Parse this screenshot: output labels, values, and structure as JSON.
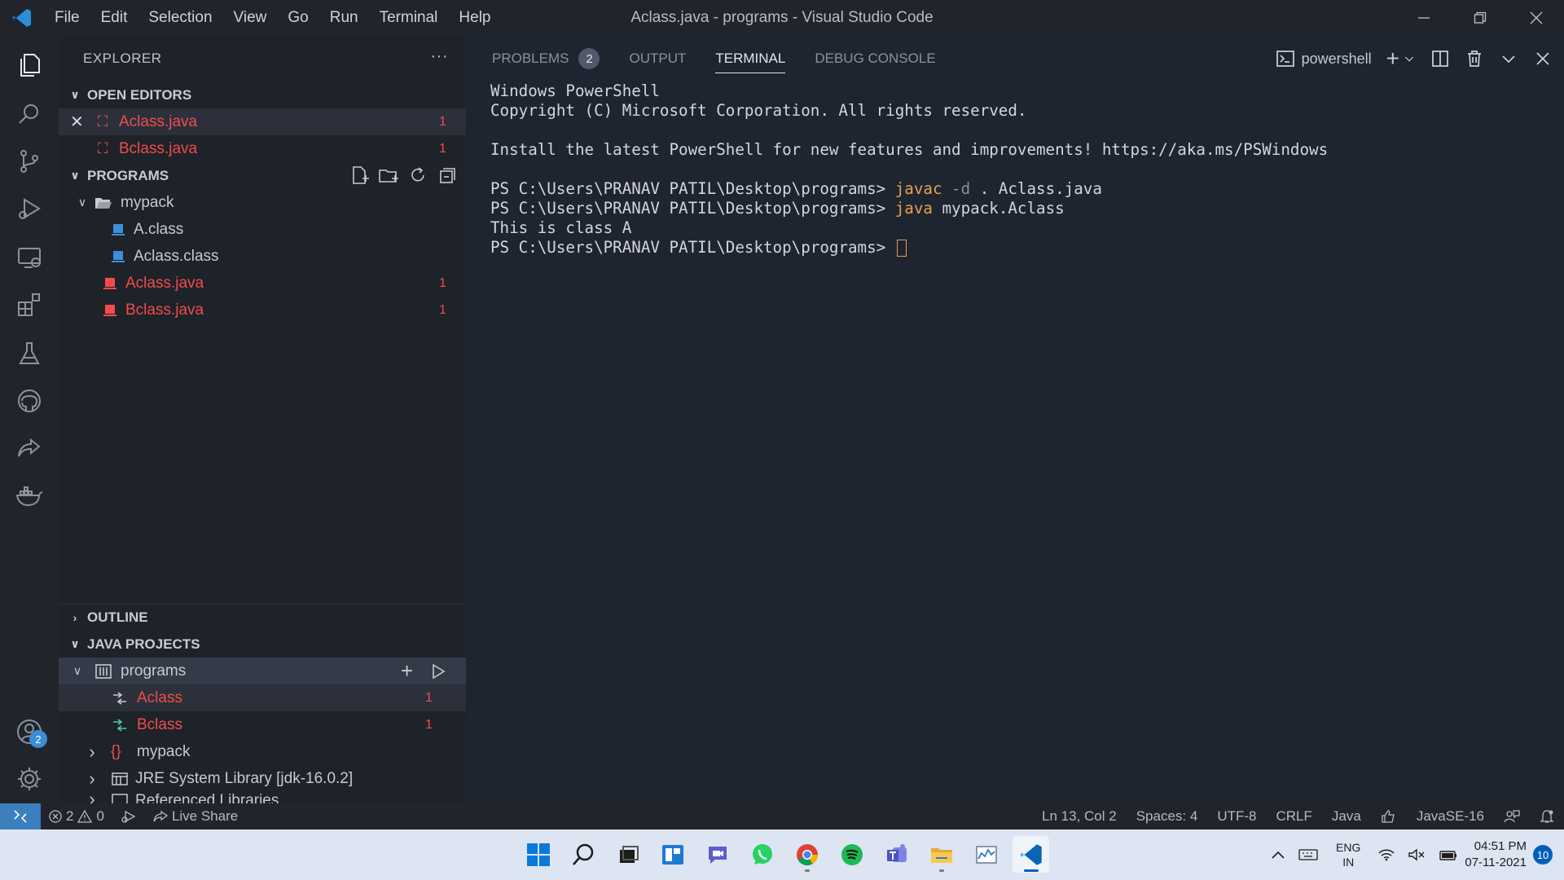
{
  "window": {
    "title": "Aclass.java - programs - Visual Studio Code",
    "menu": [
      "File",
      "Edit",
      "Selection",
      "View",
      "Go",
      "Run",
      "Terminal",
      "Help"
    ]
  },
  "activity_bar": {
    "items": [
      "explorer",
      "search",
      "source-control",
      "run-debug",
      "remote-explorer",
      "extensions",
      "testing",
      "github",
      "live-share",
      "docker"
    ],
    "accounts_badge": "2"
  },
  "sidebar": {
    "header": "EXPLORER",
    "open_editors": {
      "title": "OPEN EDITORS",
      "items": [
        {
          "name": "Aclass.java",
          "count": "1"
        },
        {
          "name": "Bclass.java",
          "count": "1"
        }
      ]
    },
    "programs": {
      "title": "PROGRAMS",
      "folder": "mypack",
      "folder_files": [
        "A.class",
        "Aclass.class"
      ],
      "files": [
        {
          "name": "Aclass.java",
          "count": "1"
        },
        {
          "name": "Bclass.java",
          "count": "1"
        }
      ]
    },
    "outline_title": "OUTLINE",
    "java_projects": {
      "title": "JAVA PROJECTS",
      "project": "programs",
      "classes": [
        {
          "name": "Aclass",
          "count": "1"
        },
        {
          "name": "Bclass",
          "count": "1"
        }
      ],
      "package": "mypack",
      "library": "JRE System Library [jdk-16.0.2]",
      "partial": "Referenced Libraries"
    }
  },
  "panel": {
    "tabs": {
      "problems": "PROBLEMS",
      "problems_count": "2",
      "output": "OUTPUT",
      "terminal": "TERMINAL",
      "debug": "DEBUG CONSOLE"
    },
    "shell": "powershell",
    "terminal": {
      "l1": "Windows PowerShell",
      "l2": "Copyright (C) Microsoft Corporation. All rights reserved.",
      "l3": "Install the latest PowerShell for new features and improvements! https://aka.ms/PSWindows",
      "prompt": "PS C:\\Users\\PRANAV PATIL\\Desktop\\programs> ",
      "cmd1": "javac",
      "cmd1_flag": " -d",
      "cmd1_rest": " . Aclass.java",
      "cmd2": "java",
      "cmd2_rest": " mypack.Aclass",
      "output": "This is class A"
    }
  },
  "statusbar": {
    "errors": "2",
    "warnings": "0",
    "live_share": "Live Share",
    "position": "Ln 13, Col 2",
    "spaces": "Spaces: 4",
    "encoding": "UTF-8",
    "eol": "CRLF",
    "language": "Java",
    "java_version": "JavaSE-16"
  },
  "taskbar": {
    "lang1": "ENG",
    "lang2": "IN",
    "time": "04:51 PM",
    "date": "07-11-2021",
    "notifications": "10"
  },
  "colors": {
    "accent": "#3c7fbf",
    "error": "#f14c4c",
    "command": "#e5a14e"
  }
}
